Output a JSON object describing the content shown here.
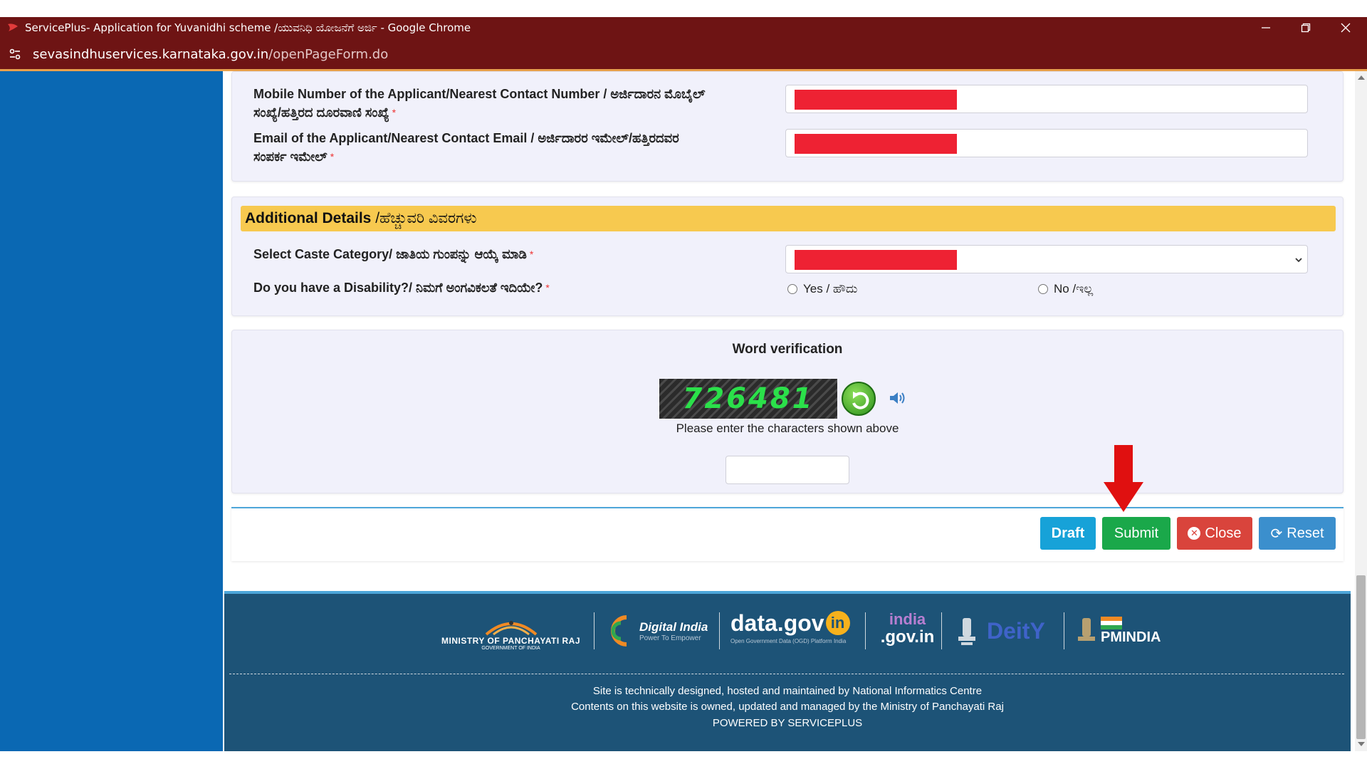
{
  "window": {
    "title": "ServicePlus- Application for Yuvanidhi scheme /ಯುವನಿಧಿ ಯೋಜನೆಗೆ ಅರ್ಜಿ - Google Chrome",
    "url_host": "sevasindhuservices.karnataka.gov.in",
    "url_path": "/openPageForm.do"
  },
  "contact": {
    "mobile_label": "Mobile Number of the Applicant/Nearest Contact Number / ಅರ್ಜಿದಾರನ ಮೊಬೈಲ್",
    "mobile_label_2": "ಸಂಖ್ಯೆ/ಹತ್ತಿರದ ದೂರವಾಣಿ ಸಂಖ್ಯೆ",
    "email_label": "Email of the Applicant/Nearest Contact Email / ಅರ್ಜಿದಾರರ ಇಮೇಲ್/ಹತ್ತಿರದವರ",
    "email_label_2": "ಸಂಪರ್ಕ ಇಮೇಲ್",
    "required_mark": "*"
  },
  "additional": {
    "heading_en": "Additional Details",
    "heading_kn": " /ಹೆಚ್ಚುವರಿ ವಿವರಗಳು",
    "caste_label": "Select Caste Category/ ಜಾತಿಯ ಗುಂಪನ್ನು ಆಯ್ಕೆ ಮಾಡಿ",
    "disability_label": "Do you have a Disability?/ ನಿಮಗೆ ಅಂಗವಿಕಲತೆ ಇದಿಯೇ?",
    "yes_label": "Yes / ಹೌದು",
    "no_label": "No /ಇಲ್ಲ"
  },
  "verification": {
    "heading": "Word verification",
    "captcha_text": "726481",
    "instruction": "Please enter the characters shown above",
    "input_value": ""
  },
  "actions": {
    "draft": "Draft",
    "submit": "Submit",
    "close": "Close",
    "reset": "Reset"
  },
  "footer": {
    "logo_panchayat": "MINISTRY OF PANCHAYATI RAJ",
    "logo_panchayat_sub": "GOVERNMENT OF INDIA",
    "logo_digital": "Digital India",
    "logo_digital_sub": "Power To Empower",
    "logo_datagov": "data.gov",
    "logo_datagov_in": "in",
    "logo_datagov_sub": "Open Government Data (OGD) Platform India",
    "logo_india_top": "india",
    "logo_india_bottom": ".gov.in",
    "logo_deity": "DeitY",
    "logo_pmindia": "PMINDIA",
    "line1": "Site is technically designed, hosted and maintained by National Informatics Centre",
    "line2": "Contents on this website is owned, updated and managed by the Ministry of Panchayati Raj",
    "line3": "POWERED BY SERVICEPLUS"
  },
  "colors": {
    "titlebar": "#6e1414",
    "sidebar": "#0a68b3",
    "draft": "#17a2d8",
    "submit": "#1aa84a",
    "close": "#d9443c",
    "reset": "#3b8fcd",
    "arrow": "#e01010"
  }
}
